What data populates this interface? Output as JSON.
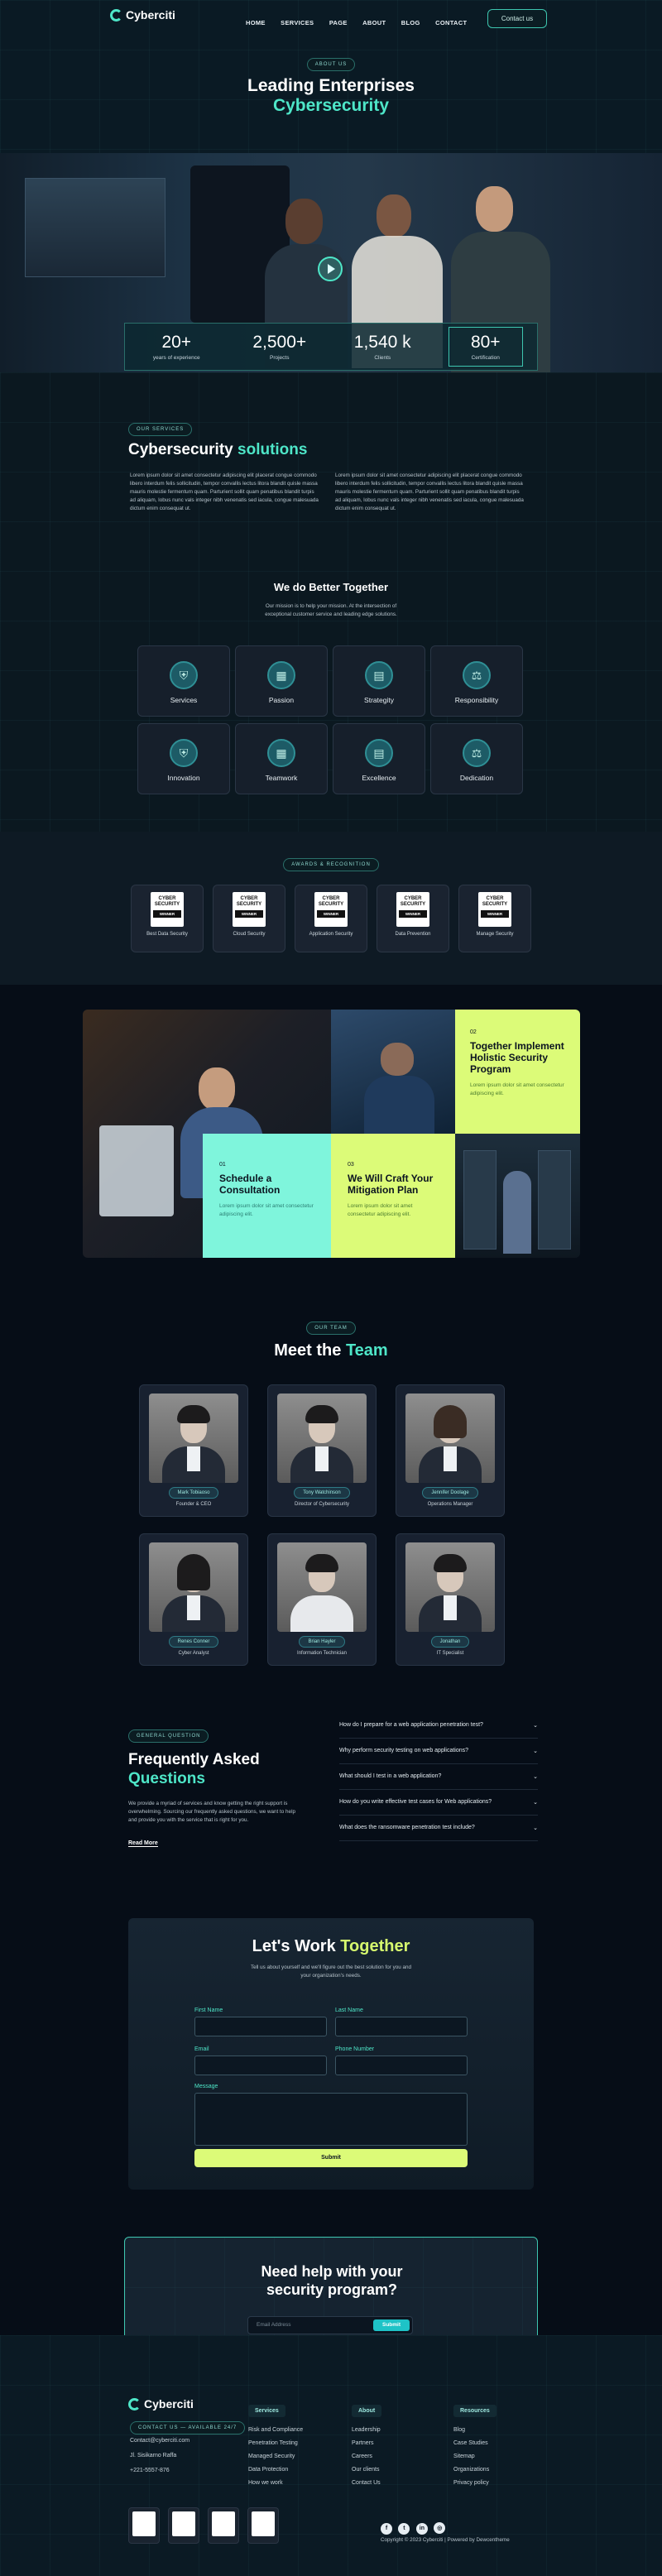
{
  "brand": {
    "name": "Cyberciti"
  },
  "nav": {
    "items": [
      "HOME",
      "SERVICES",
      "PAGE",
      "ABOUT",
      "BLOG",
      "CONTACT"
    ],
    "contact_button": "Contact us"
  },
  "hero": {
    "pill": "ABOUT US",
    "title_line1": "Leading Enterprises",
    "title_line2": "Cybersecurity"
  },
  "stats": [
    {
      "value": "20+",
      "label": "years of experience"
    },
    {
      "value": "2,500+",
      "label": "Projects"
    },
    {
      "value": "1,540 k",
      "label": "Clients"
    },
    {
      "value": "80+",
      "label": "Certification"
    }
  ],
  "solutions": {
    "pill": "OUR SERVICES",
    "title_a": "Cybersecurity",
    "title_b": "solutions",
    "para1": "Lorem ipsum dolor sit amet consectetur adipiscing elit placerat congue commodo libero interdum felis sollicitudin, tempor convallis lectus litora blandit quisle massa mauris molestie fermentum quam. Parturient sollit quam penatibus blandit turpis ad aliquam, lobus nunc vals integer nibh venenatis sed iacula, congue malesuada dictum enim consequat ut.",
    "para2": "Lorem ipsum dolor sit amet consectetur adipiscing elit placerat congue commodo libero interdum felis sollicitudin, tempor convallis lectus litora blandit quisle massa mauris molestie fermentum quam. Parturient sollit quam penatibus blandit turpis ad aliquam, lobus nunc vals integer nibh venenatis sed iacula, congue malesuada dictum enim consequat ut."
  },
  "better": {
    "title": "We do Better Together",
    "subtitle": "Our mission is to help your mission. At the intersection of exceptional customer service and leading edge solutions.",
    "cards": [
      "Services",
      "Passion",
      "Strategity",
      "Responsibility",
      "Innovation",
      "Teamwork",
      "Excellence",
      "Dedication"
    ]
  },
  "awards": {
    "pill": "AWARDS & RECOGNITION",
    "logo_text": "CYBER SECURITY",
    "logo_sub": "WINNER",
    "items": [
      "Best Data Security",
      "Cloud Security",
      "Application Security",
      "Data Prevention",
      "Manage Security"
    ]
  },
  "program": {
    "p02": {
      "num": "02",
      "title": "Together Implement Holistic Security Program",
      "text": "Lorem ipsum dolor sit amet consectetur adipiscing elit."
    },
    "p01": {
      "num": "01",
      "title": "Schedule a Consultation",
      "text": "Lorem ipsum dolor sit amet consectetur adipiscing elit."
    },
    "p03": {
      "num": "03",
      "title": "We Will Craft Your Mitigation Plan",
      "text": "Lorem ipsum dolor sit amet consectetur adipiscing elit."
    }
  },
  "team": {
    "pill": "OUR TEAM",
    "title_a": "Meet the",
    "title_b": "Team",
    "members": [
      {
        "name": "Mark Tobiaoso",
        "role": "Founder & CEO"
      },
      {
        "name": "Tony Watchinson",
        "role": "Director of Cybersecurity"
      },
      {
        "name": "Jennifer Doolage",
        "role": "Operations Manager"
      },
      {
        "name": "Renes Conner",
        "role": "Cyber Analyst"
      },
      {
        "name": "Brian Hayler",
        "role": "Information Technician"
      },
      {
        "name": "Jonathan",
        "role": "IT Specialist"
      }
    ]
  },
  "faq": {
    "pill": "GENERAL QUESTION",
    "title_a": "Frequently Asked",
    "title_b": "Questions",
    "text": "We provide a myriad of services and know getting the right support is overwhelming. Sourcing our frequently asked questions, we want to help and provide you with the service that is right for you.",
    "read_more": "Read More",
    "items": [
      "How do I prepare for a web application penetration test?",
      "Why perform security testing on web applications?",
      "What should I test in a web application?",
      "How do you write effective test cases for Web applications?",
      "What does the ransomware penetration test include?"
    ]
  },
  "form": {
    "title_a": "Let's Work",
    "title_b": "Together",
    "subtitle": "Tell us about yourself and we'll figure out the best solution for you and your organization's needs.",
    "first_name": "First Name",
    "last_name": "Last Name",
    "email": "Email",
    "phone": "Phone Number",
    "message": "Message",
    "submit": "Submit"
  },
  "help": {
    "title": "Need help with your security program?",
    "placeholder": "Email Address",
    "button": "Submit"
  },
  "footer": {
    "contact_pill": "CONTACT US — AVAILABLE 24/7",
    "email": "Contact@cyberciti.com",
    "address": "Jl. Sisikarno Raffa",
    "phone": "+221-5557-876",
    "cols": [
      {
        "head": "Services",
        "links": [
          "Risk and Compliance",
          "Penetration Testing",
          "Managed Security",
          "Data Protection",
          "How we work"
        ]
      },
      {
        "head": "About",
        "links": [
          "Leadership",
          "Partners",
          "Careers",
          "Our clients",
          "Contact Us"
        ]
      },
      {
        "head": "Resources",
        "links": [
          "Blog",
          "Case Studies",
          "Sitemap",
          "Organizations",
          "Privacy policy"
        ]
      }
    ],
    "copyright": "Copyright © 2023 Cyberciti | Powered by Dewcentheme"
  },
  "colors": {
    "accent": "#4ee6c8",
    "lime": "#d6f96e",
    "bg": "#060d17"
  }
}
